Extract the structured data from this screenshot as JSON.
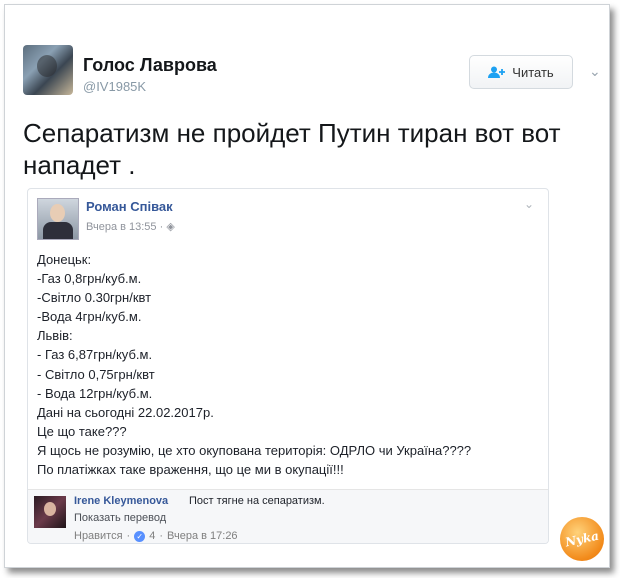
{
  "tweet": {
    "author_name": "Голос Лаврова",
    "author_handle": "@IV1985K",
    "follow_label": "Читать",
    "text": "Сепаратизм не пройдет Путин тиран вот вот нападет ."
  },
  "embedded_post": {
    "author_name": "Роман Співак",
    "time": "Вчера в 13:55 · ",
    "lines": [
      "Донецьк:",
      "-Газ 0,8грн/куб.м.",
      "-Світло 0.30грн/квт",
      "-Вода 4грн/куб.м.",
      "Львів:",
      "- Газ 6,87грн/куб.м.",
      "- Світло 0,75грн/квт",
      "- Вода 12грн/куб.м.",
      "Дані на сьогодні 22.02.2017р.",
      "Це що таке???",
      "Я щось не розумію, це хто окупована територія: ОДРЛО чи Україна????",
      "По платіжках таке враження, що це ми в окупації!!!"
    ],
    "comment": {
      "author": "Irene Kleymenova",
      "text": "Пост тягне на сепаратизм.",
      "translate": "Показать перевод",
      "like_label": "Нравится",
      "likes": "4",
      "time": "Вчера в 17:26"
    }
  },
  "watermark_text": "Nyka",
  "colors": {
    "fb_link": "#365899",
    "twitter_gray": "#8899a6",
    "accent_blue": "#1da1f2"
  }
}
